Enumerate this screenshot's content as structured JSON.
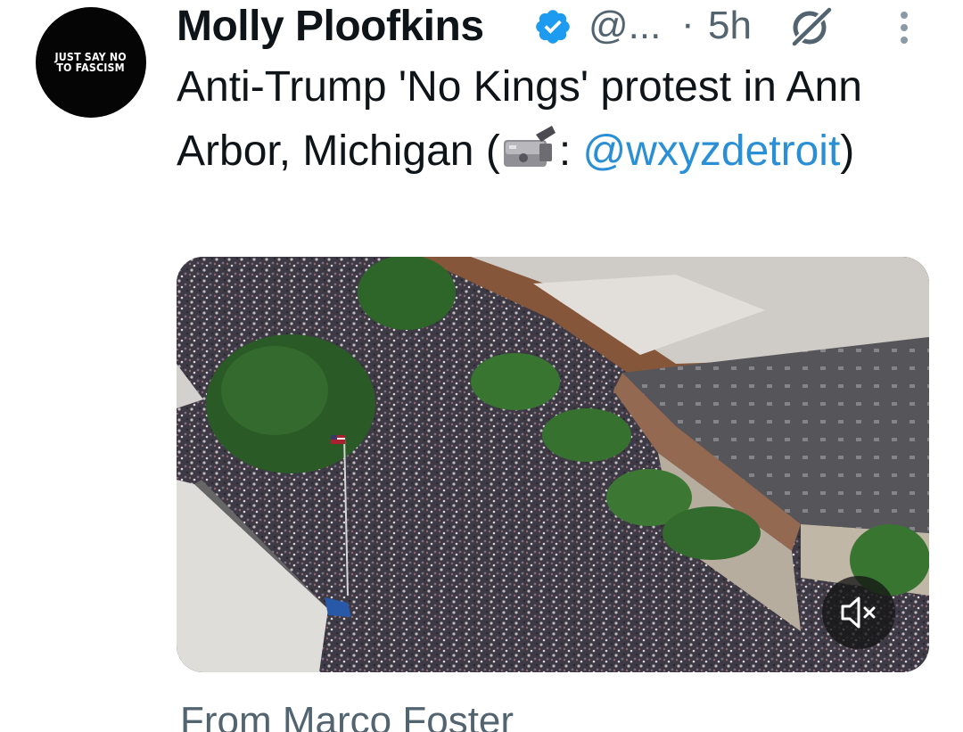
{
  "avatar": {
    "line1": "JUST SAY NO",
    "line2": "TO FASCISM"
  },
  "header": {
    "display_name": "Molly Ploofkins",
    "handle": "@...",
    "separator": "·",
    "time": "5h"
  },
  "tweet": {
    "text_part1": "Anti-Trump 'No Kings' protest in Ann Arbor, Michigan (",
    "camera_icon": "video-camera-icon",
    "text_part2": ": ",
    "mention": "@wxyzdetroit",
    "text_part3": ")"
  },
  "media": {
    "type": "video",
    "muted": true
  },
  "footer": {
    "from_text": "From Marco Foster"
  },
  "colors": {
    "verified": "#1d9bf0",
    "mention": "#2b8fd6",
    "secondary_text": "#536471",
    "primary_text": "#0f1419"
  }
}
